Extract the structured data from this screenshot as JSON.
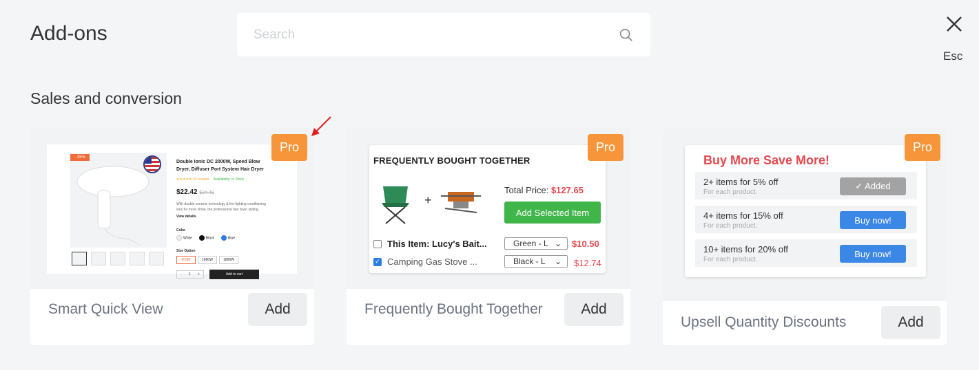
{
  "header": {
    "title": "Add-ons",
    "search_placeholder": "Search",
    "search_value": "",
    "close_hint": "Esc"
  },
  "section_title": "Sales and conversion",
  "colors": {
    "pro_badge": "#f7953a",
    "accent_red": "#e5484d",
    "accent_green": "#3fb54a",
    "accent_blue": "#3b87e6"
  },
  "cards": [
    {
      "name": "Smart Quick View",
      "badge": "Pro",
      "add_label": "Add",
      "preview": {
        "sale_tag": "- 35%",
        "product_title": "Double Ionic DC 2000W, Speed Blow Dryer, Diffuser Port System Hair Dryer",
        "reviews": "★★★★★ 40 reviews",
        "availability": "Availability: In Stock",
        "price": "$22.42",
        "old_price": "$34.49",
        "description": "With double ceramic technology & fire-fighting conditioning ions for more shine, the professional hair dryer styling.",
        "view_details": "View details",
        "color_label": "Color",
        "colors": [
          "White",
          "Black",
          "Blue"
        ],
        "size_label": "Size Option",
        "sizes": [
          "600W",
          "1600W",
          "1800W"
        ],
        "qty": "1",
        "cart_label": "Add to cart"
      }
    },
    {
      "name": "Frequently Bought Together",
      "badge": "Pro",
      "add_label": "Add",
      "preview": {
        "heading": "FREQUENTLY BOUGHT TOGETHER",
        "total_label": "Total Price:",
        "total_value": "$127.65",
        "button": "Add Selected Item",
        "items": [
          {
            "label": "This Item: Lucy's Bait...",
            "variant": "Green - L",
            "price": "$10.50",
            "checked": false
          },
          {
            "label": "Camping Gas Stove ...",
            "variant": "Black - L",
            "price": "$12.74",
            "checked": true
          }
        ]
      }
    },
    {
      "name": "Upsell Quantity Discounts",
      "badge": "Pro",
      "add_label": "Add",
      "preview": {
        "heading": "Buy More Save More!",
        "tiers": [
          {
            "title": "2+ items for 5% off",
            "sub": "For  each product.",
            "button": "✓ Added"
          },
          {
            "title": "4+ items for 15% off",
            "sub": "For  each product.",
            "button": "Buy now!"
          },
          {
            "title": "10+ items for 20% off",
            "sub": "For  each product.",
            "button": "Buy now!"
          }
        ]
      }
    }
  ]
}
